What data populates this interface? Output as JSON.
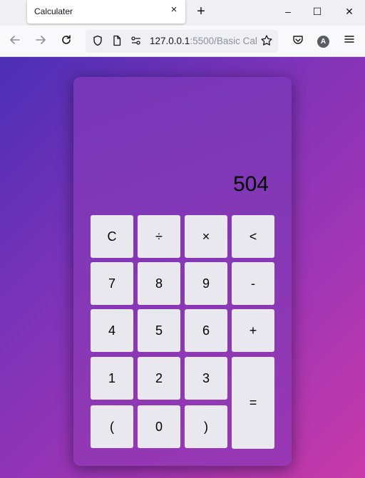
{
  "browser": {
    "tab_title": "Calculater",
    "tab_close_icon": "×",
    "new_tab_icon": "+",
    "window_minimize": "–",
    "window_maximize": "☐",
    "window_close": "✕",
    "url_host": "127.0.0.1",
    "url_rest": ":5500/Basic Cal",
    "avatar_letter": "A"
  },
  "calculator": {
    "display": "504",
    "keys": {
      "clear": "C",
      "divide": "÷",
      "multiply": "×",
      "backspace": "<",
      "seven": "7",
      "eight": "8",
      "nine": "9",
      "minus": "-",
      "four": "4",
      "five": "5",
      "six": "6",
      "plus": "+",
      "one": "1",
      "two": "2",
      "three": "3",
      "equals": "=",
      "open_paren": "(",
      "zero": "0",
      "close_paren": ")"
    }
  },
  "colors": {
    "page_gradient_start": "#4a2fb5",
    "page_gradient_end": "#c93aa8",
    "calculator_body": "#8a38b5",
    "key_background": "#e9e8ee"
  }
}
